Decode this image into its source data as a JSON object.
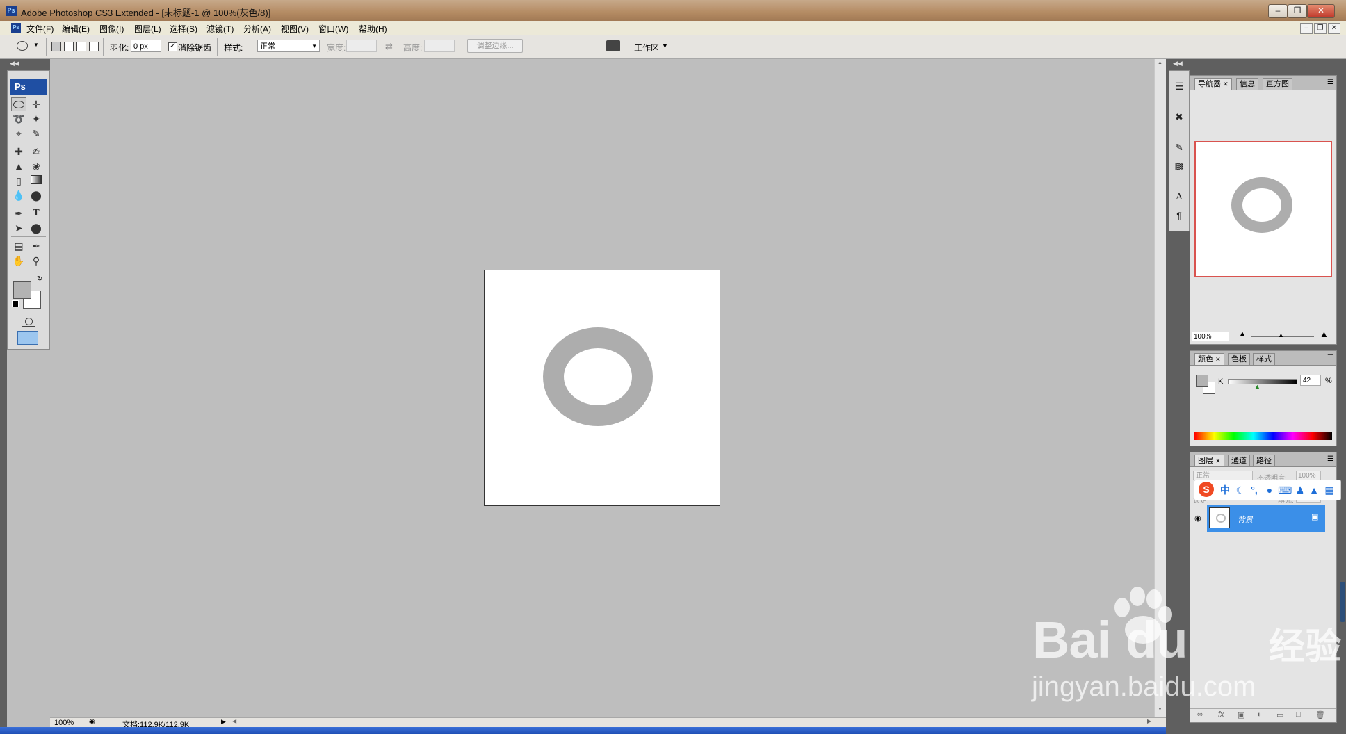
{
  "window": {
    "title": "Adobe Photoshop CS3 Extended - [未标题-1 @ 100%(灰色/8)]",
    "app_icon": "Ps",
    "controls": [
      "minimize-icon",
      "restore-icon",
      "close-icon"
    ]
  },
  "menubar": {
    "doc_icon": "Ps",
    "items": [
      "文件(F)",
      "编辑(E)",
      "图像(I)",
      "图层(L)",
      "选择(S)",
      "滤镜(T)",
      "分析(A)",
      "视图(V)",
      "窗口(W)",
      "帮助(H)"
    ]
  },
  "options": {
    "feather_label": "羽化:",
    "feather_value": "0 px",
    "antialias_label": "消除锯齿",
    "antialias_checked": true,
    "style_label": "样式:",
    "style_value": "正常",
    "width_label": "宽度:",
    "height_label": "高度:",
    "refine_edge": "调整边缘...",
    "workspace": "工作区"
  },
  "toolbox": {
    "logo": "Ps",
    "tools": [
      "elliptical-marquee-icon",
      "move-icon",
      "lasso-icon",
      "magic-wand-icon",
      "crop-icon",
      "slice-icon",
      "healing-brush-icon",
      "brush-icon",
      "clone-stamp-icon",
      "history-brush-icon",
      "eraser-icon",
      "gradient-icon",
      "blur-icon",
      "dodge-icon",
      "pen-icon",
      "type-icon",
      "path-selection-icon",
      "ellipse-shape-icon",
      "notes-icon",
      "eyedropper-icon",
      "hand-icon",
      "zoom-icon"
    ],
    "foreground_color": "#b3b3b3",
    "background_color": "#ffffff"
  },
  "document": {
    "ring_color": "#adadad",
    "canvas_color": "#ffffff"
  },
  "status": {
    "zoom": "100%",
    "doc_info": "文档:112.9K/112.9K"
  },
  "navigator_panel": {
    "tabs": [
      "导航器",
      "信息",
      "直方图"
    ],
    "zoom": "100%"
  },
  "color_panel": {
    "tabs": [
      "颜色",
      "色板",
      "样式"
    ],
    "channel_label": "K",
    "value": "42",
    "unit": "%"
  },
  "layers_panel": {
    "tabs": [
      "图层",
      "通道",
      "路径"
    ],
    "blend_mode": "正常",
    "opacity_label": "不透明度:",
    "opacity_value": "100%",
    "lock_label": "锁定:",
    "fill_label": "填充:",
    "fill_value": "100%",
    "layer_name": "背景"
  },
  "ime": {
    "items": [
      "sogou-logo-icon",
      "中",
      "moon-icon",
      "punctuation-icon",
      "mic-icon",
      "keyboard-icon",
      "user-icon",
      "shirt-icon",
      "grid-icon"
    ]
  },
  "watermark": {
    "brand": "Bai",
    "brand_suffix": "du",
    "cn": "经验",
    "url": "jingyan.baidu.com"
  }
}
